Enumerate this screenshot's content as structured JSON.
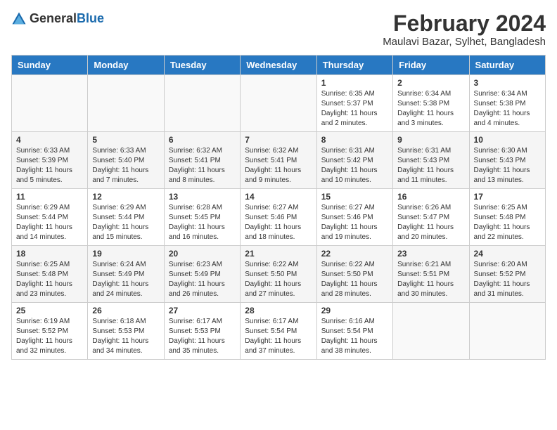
{
  "header": {
    "logo_general": "General",
    "logo_blue": "Blue",
    "title": "February 2024",
    "location": "Maulavi Bazar, Sylhet, Bangladesh"
  },
  "calendar": {
    "days_of_week": [
      "Sunday",
      "Monday",
      "Tuesday",
      "Wednesday",
      "Thursday",
      "Friday",
      "Saturday"
    ],
    "weeks": [
      [
        {
          "day": "",
          "info": ""
        },
        {
          "day": "",
          "info": ""
        },
        {
          "day": "",
          "info": ""
        },
        {
          "day": "",
          "info": ""
        },
        {
          "day": "1",
          "info": "Sunrise: 6:35 AM\nSunset: 5:37 PM\nDaylight: 11 hours and 2 minutes."
        },
        {
          "day": "2",
          "info": "Sunrise: 6:34 AM\nSunset: 5:38 PM\nDaylight: 11 hours and 3 minutes."
        },
        {
          "day": "3",
          "info": "Sunrise: 6:34 AM\nSunset: 5:38 PM\nDaylight: 11 hours and 4 minutes."
        }
      ],
      [
        {
          "day": "4",
          "info": "Sunrise: 6:33 AM\nSunset: 5:39 PM\nDaylight: 11 hours and 5 minutes."
        },
        {
          "day": "5",
          "info": "Sunrise: 6:33 AM\nSunset: 5:40 PM\nDaylight: 11 hours and 7 minutes."
        },
        {
          "day": "6",
          "info": "Sunrise: 6:32 AM\nSunset: 5:41 PM\nDaylight: 11 hours and 8 minutes."
        },
        {
          "day": "7",
          "info": "Sunrise: 6:32 AM\nSunset: 5:41 PM\nDaylight: 11 hours and 9 minutes."
        },
        {
          "day": "8",
          "info": "Sunrise: 6:31 AM\nSunset: 5:42 PM\nDaylight: 11 hours and 10 minutes."
        },
        {
          "day": "9",
          "info": "Sunrise: 6:31 AM\nSunset: 5:43 PM\nDaylight: 11 hours and 11 minutes."
        },
        {
          "day": "10",
          "info": "Sunrise: 6:30 AM\nSunset: 5:43 PM\nDaylight: 11 hours and 13 minutes."
        }
      ],
      [
        {
          "day": "11",
          "info": "Sunrise: 6:29 AM\nSunset: 5:44 PM\nDaylight: 11 hours and 14 minutes."
        },
        {
          "day": "12",
          "info": "Sunrise: 6:29 AM\nSunset: 5:44 PM\nDaylight: 11 hours and 15 minutes."
        },
        {
          "day": "13",
          "info": "Sunrise: 6:28 AM\nSunset: 5:45 PM\nDaylight: 11 hours and 16 minutes."
        },
        {
          "day": "14",
          "info": "Sunrise: 6:27 AM\nSunset: 5:46 PM\nDaylight: 11 hours and 18 minutes."
        },
        {
          "day": "15",
          "info": "Sunrise: 6:27 AM\nSunset: 5:46 PM\nDaylight: 11 hours and 19 minutes."
        },
        {
          "day": "16",
          "info": "Sunrise: 6:26 AM\nSunset: 5:47 PM\nDaylight: 11 hours and 20 minutes."
        },
        {
          "day": "17",
          "info": "Sunrise: 6:25 AM\nSunset: 5:48 PM\nDaylight: 11 hours and 22 minutes."
        }
      ],
      [
        {
          "day": "18",
          "info": "Sunrise: 6:25 AM\nSunset: 5:48 PM\nDaylight: 11 hours and 23 minutes."
        },
        {
          "day": "19",
          "info": "Sunrise: 6:24 AM\nSunset: 5:49 PM\nDaylight: 11 hours and 24 minutes."
        },
        {
          "day": "20",
          "info": "Sunrise: 6:23 AM\nSunset: 5:49 PM\nDaylight: 11 hours and 26 minutes."
        },
        {
          "day": "21",
          "info": "Sunrise: 6:22 AM\nSunset: 5:50 PM\nDaylight: 11 hours and 27 minutes."
        },
        {
          "day": "22",
          "info": "Sunrise: 6:22 AM\nSunset: 5:50 PM\nDaylight: 11 hours and 28 minutes."
        },
        {
          "day": "23",
          "info": "Sunrise: 6:21 AM\nSunset: 5:51 PM\nDaylight: 11 hours and 30 minutes."
        },
        {
          "day": "24",
          "info": "Sunrise: 6:20 AM\nSunset: 5:52 PM\nDaylight: 11 hours and 31 minutes."
        }
      ],
      [
        {
          "day": "25",
          "info": "Sunrise: 6:19 AM\nSunset: 5:52 PM\nDaylight: 11 hours and 32 minutes."
        },
        {
          "day": "26",
          "info": "Sunrise: 6:18 AM\nSunset: 5:53 PM\nDaylight: 11 hours and 34 minutes."
        },
        {
          "day": "27",
          "info": "Sunrise: 6:17 AM\nSunset: 5:53 PM\nDaylight: 11 hours and 35 minutes."
        },
        {
          "day": "28",
          "info": "Sunrise: 6:17 AM\nSunset: 5:54 PM\nDaylight: 11 hours and 37 minutes."
        },
        {
          "day": "29",
          "info": "Sunrise: 6:16 AM\nSunset: 5:54 PM\nDaylight: 11 hours and 38 minutes."
        },
        {
          "day": "",
          "info": ""
        },
        {
          "day": "",
          "info": ""
        }
      ]
    ]
  }
}
